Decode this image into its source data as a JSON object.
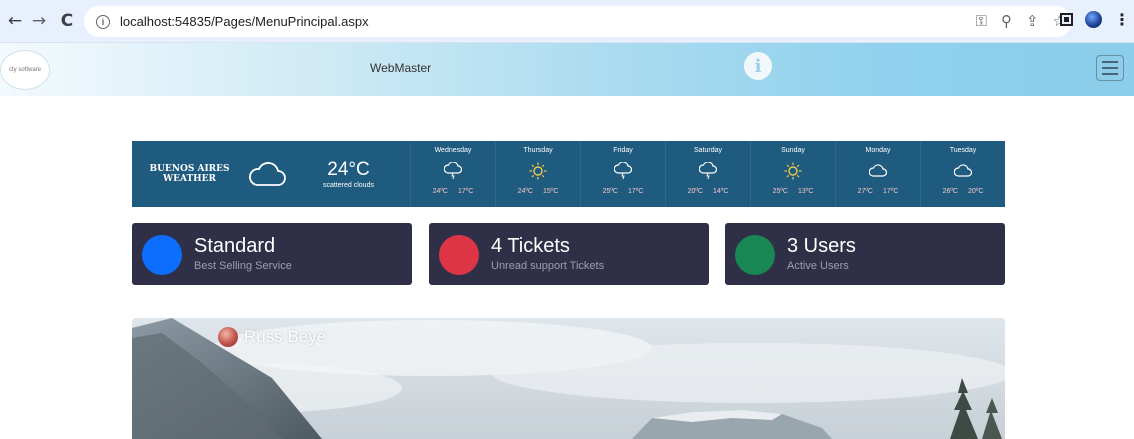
{
  "browser": {
    "url": "localhost:54835/Pages/MenuPrincipal.aspx"
  },
  "header": {
    "logo_text": "cty software",
    "brand": "WebMaster"
  },
  "weather": {
    "city_line1": "BUENOS AIRES",
    "city_line2": "WEATHER",
    "current_temp": "24°C",
    "current_desc": "scattered clouds",
    "current_icon": "cloud-icon",
    "days": [
      {
        "name": "Wednesday",
        "icon": "rain-cloud-icon",
        "high": "24ºC",
        "low": "17ºC"
      },
      {
        "name": "Thursday",
        "icon": "sun-icon",
        "high": "24ºC",
        "low": "15ºC"
      },
      {
        "name": "Friday",
        "icon": "rain-cloud-icon",
        "high": "25ºC",
        "low": "17ºC"
      },
      {
        "name": "Saturday",
        "icon": "rain-cloud-icon",
        "high": "20ºC",
        "low": "14ºC"
      },
      {
        "name": "Sunday",
        "icon": "sun-icon",
        "high": "25ºC",
        "low": "13ºC"
      },
      {
        "name": "Monday",
        "icon": "cloud-icon",
        "high": "27ºC",
        "low": "17ºC"
      },
      {
        "name": "Tuesday",
        "icon": "cloud-icon",
        "high": "26ºC",
        "low": "20ºC"
      }
    ]
  },
  "cards": [
    {
      "title": "Standard",
      "subtitle": "Best Selling Service",
      "color": "#0d6efd"
    },
    {
      "title": "4 Tickets",
      "subtitle": "Unread support Tickets",
      "color": "#dc3545"
    },
    {
      "title": "3 Users",
      "subtitle": "Active Users",
      "color": "#198754"
    }
  ],
  "hero": {
    "user_name": "Russ Beye"
  },
  "colors": {
    "weather_bg": "#1f5b7e",
    "card_bg": "#2f3047"
  }
}
